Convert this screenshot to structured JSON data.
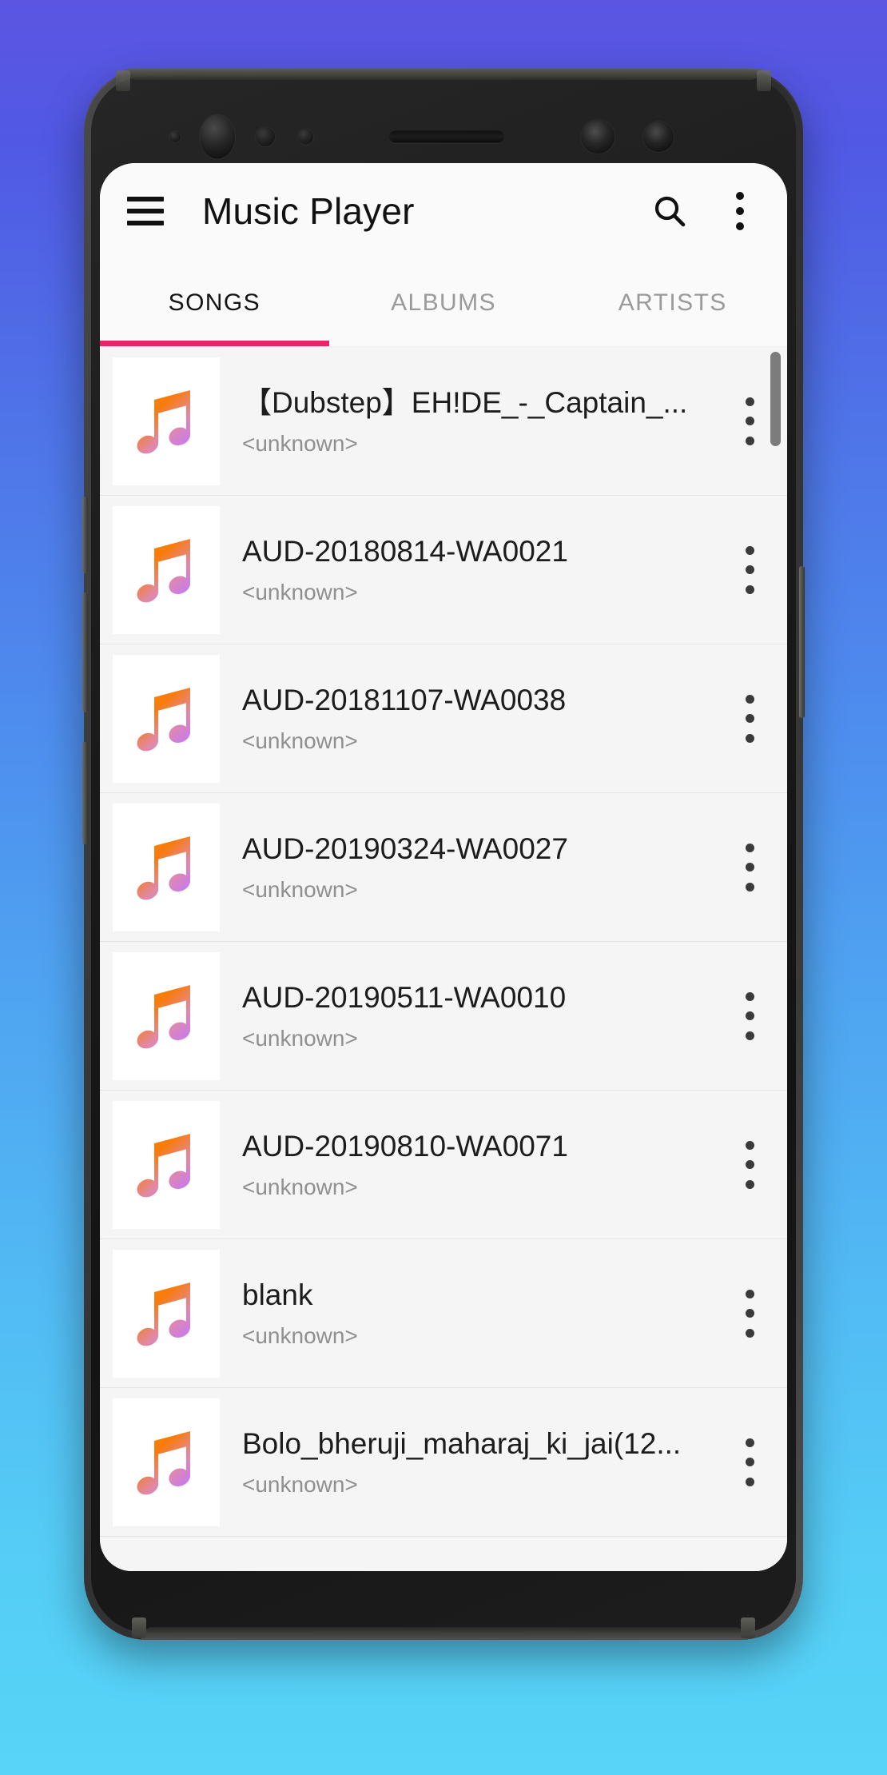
{
  "appbar": {
    "title": "Music Player",
    "menu_icon": "hamburger-menu-icon",
    "search_icon": "search-icon",
    "overflow_icon": "more-vertical-icon"
  },
  "tabs": [
    {
      "label": "SONGS",
      "active": true
    },
    {
      "label": "ALBUMS",
      "active": false
    },
    {
      "label": "ARTISTS",
      "active": false
    }
  ],
  "colors": {
    "accent": "#e8256b",
    "screen_bg": "#fafafa",
    "list_bg": "#f5f5f5",
    "title_text": "#1c1c1c",
    "subtitle_text": "#8f8f8f",
    "tab_inactive": "#9a9a9a",
    "note_gradient_start": "#f97b0c",
    "note_gradient_end": "#c77bf0",
    "bg_gradient_top": "#5b55e2",
    "bg_gradient_bottom": "#57d4f7"
  },
  "songs": [
    {
      "title": "【Dubstep】EH!DE_-_Captain_...",
      "artist": "<unknown>",
      "icon": "music-note-icon",
      "overflow": "more-vertical-icon"
    },
    {
      "title": "AUD-20180814-WA0021",
      "artist": "<unknown>",
      "icon": "music-note-icon",
      "overflow": "more-vertical-icon"
    },
    {
      "title": "AUD-20181107-WA0038",
      "artist": "<unknown>",
      "icon": "music-note-icon",
      "overflow": "more-vertical-icon"
    },
    {
      "title": "AUD-20190324-WA0027",
      "artist": "<unknown>",
      "icon": "music-note-icon",
      "overflow": "more-vertical-icon"
    },
    {
      "title": "AUD-20190511-WA0010",
      "artist": "<unknown>",
      "icon": "music-note-icon",
      "overflow": "more-vertical-icon"
    },
    {
      "title": "AUD-20190810-WA0071",
      "artist": "<unknown>",
      "icon": "music-note-icon",
      "overflow": "more-vertical-icon"
    },
    {
      "title": "blank",
      "artist": "<unknown>",
      "icon": "music-note-icon",
      "overflow": "more-vertical-icon"
    },
    {
      "title": "Bolo_bheruji_maharaj_ki_jai(12...",
      "artist": "<unknown>",
      "icon": "music-note-icon",
      "overflow": "more-vertical-icon"
    }
  ],
  "device": {
    "hardware": [
      "volume-up-button",
      "volume-down-button",
      "bixby-button",
      "power-button"
    ],
    "sensors": [
      "proximity-sensor",
      "front-camera",
      "iris-sensor",
      "led-indicator",
      "earpiece-speaker",
      "camera-lens-1",
      "camera-lens-2"
    ]
  }
}
